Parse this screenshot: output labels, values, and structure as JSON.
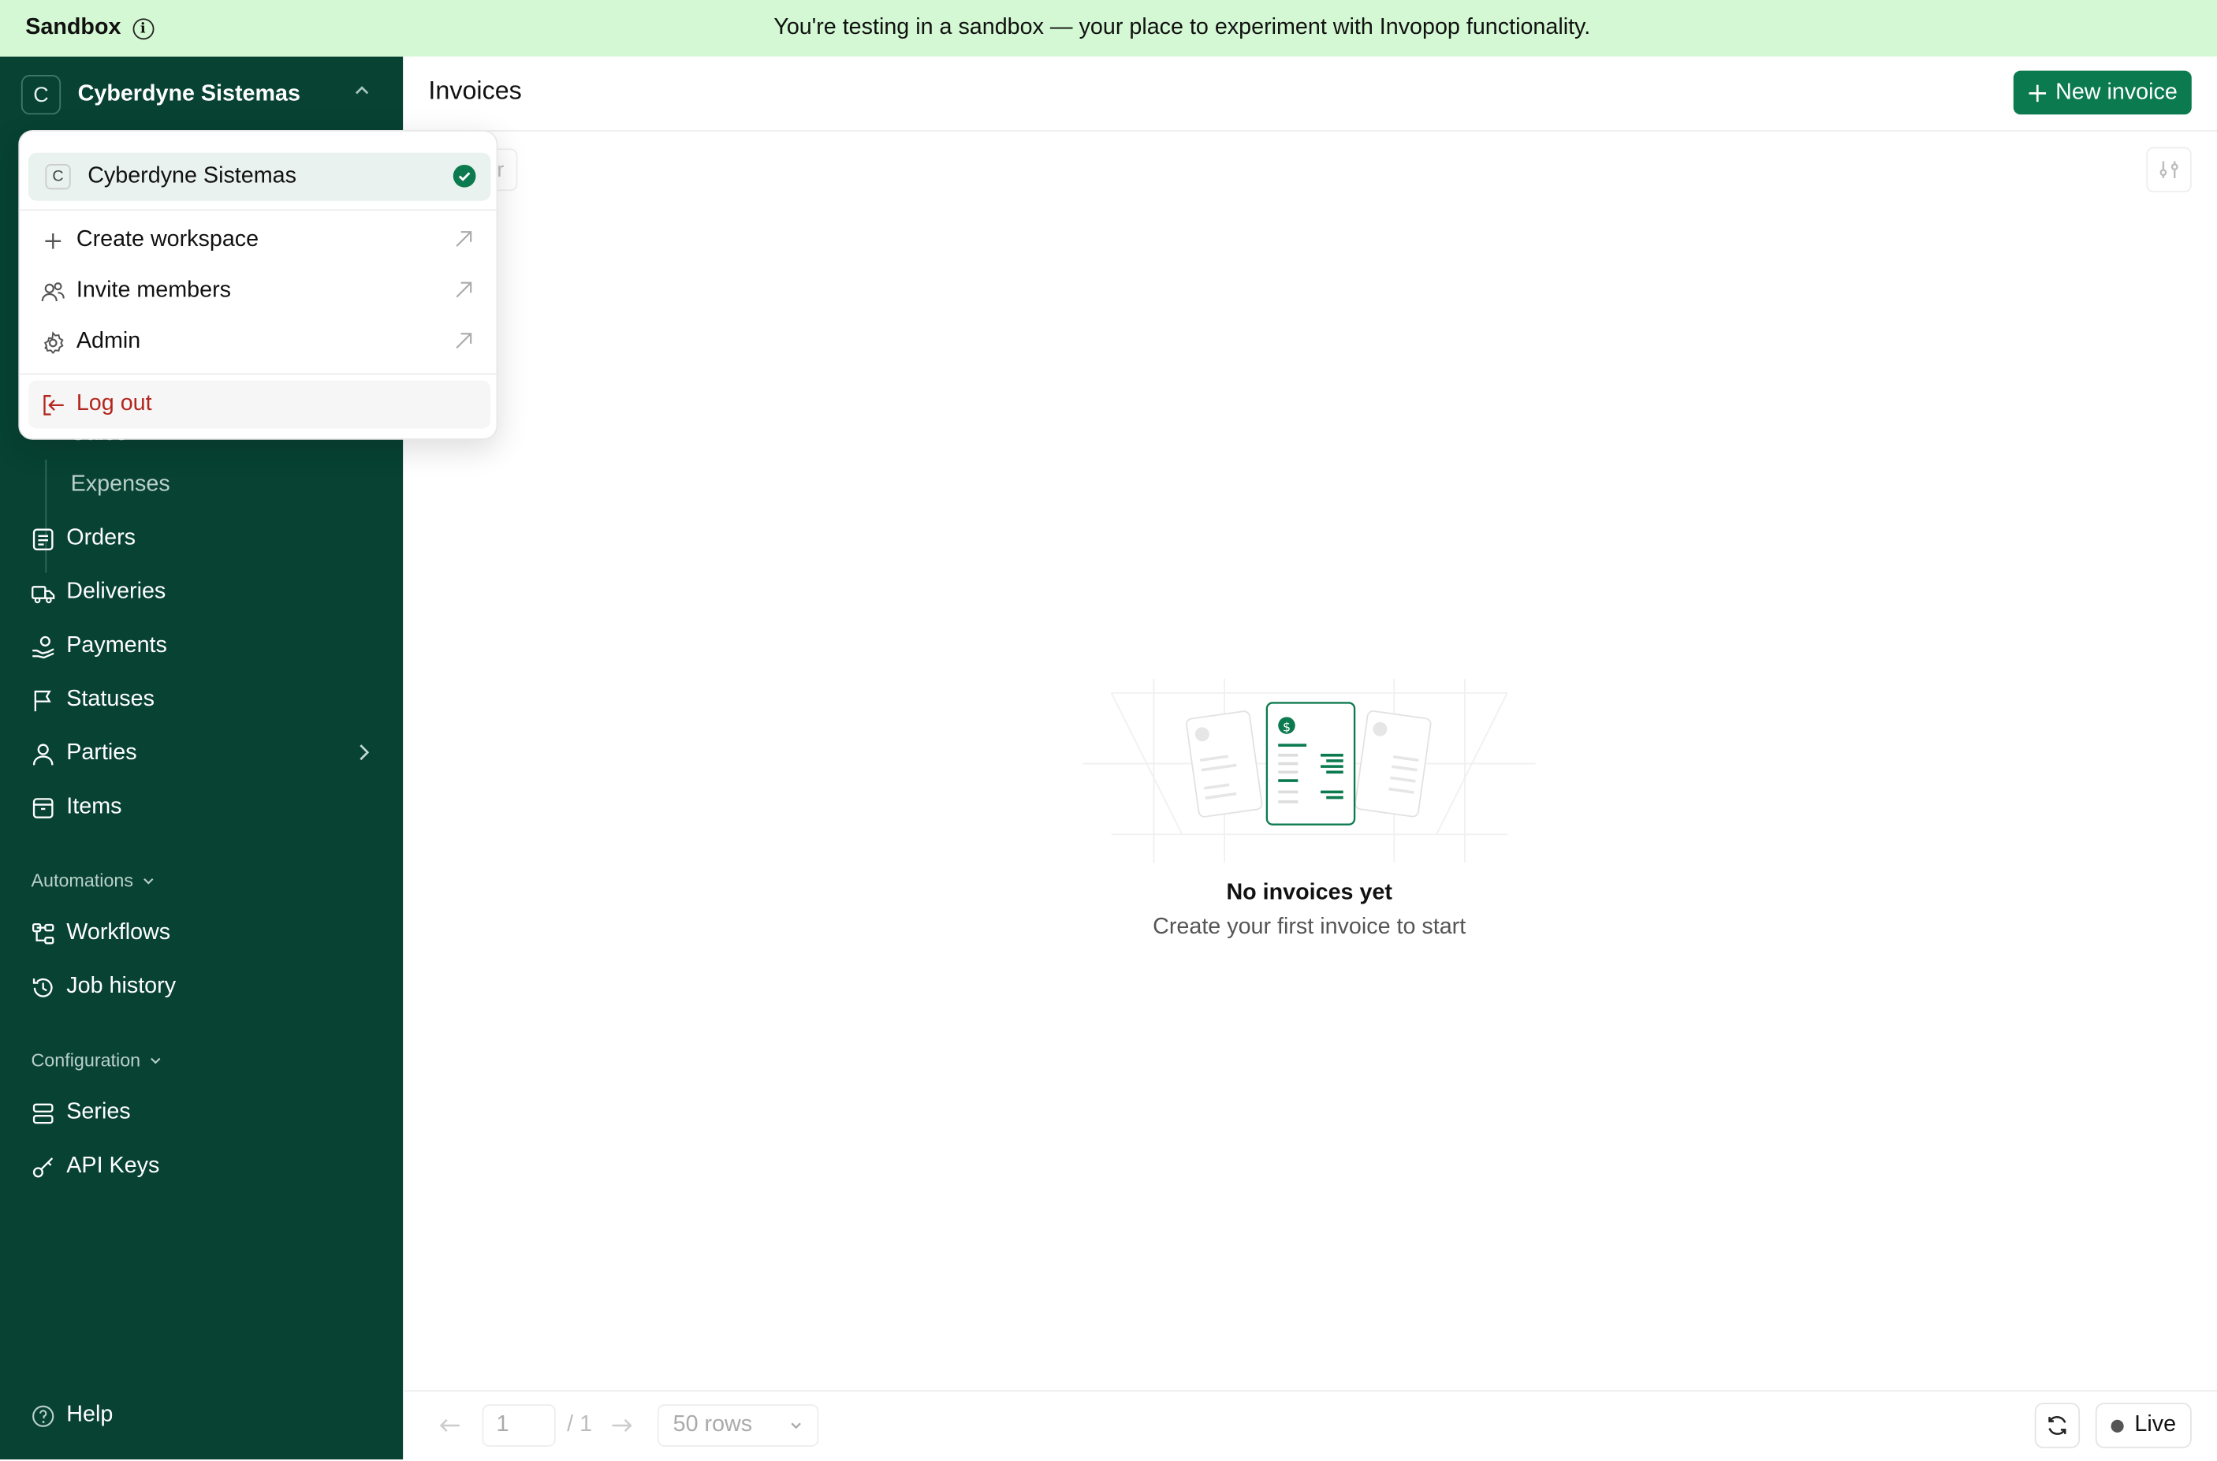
{
  "banner": {
    "label": "Sandbox",
    "message": "You're testing in a sandbox — your place to experiment with Invopop functionality."
  },
  "sidebar": {
    "workspace_initial": "C",
    "workspace_name": "Cyberdyne Sistemas",
    "partial_item": "Sales",
    "sub_items": [
      "Expenses"
    ],
    "items": [
      "Orders",
      "Deliveries",
      "Payments",
      "Statuses",
      "Parties",
      "Items"
    ],
    "sections": {
      "automations": {
        "label": "Automations",
        "items": [
          "Workflows",
          "Job history"
        ]
      },
      "configuration": {
        "label": "Configuration",
        "items": [
          "Series",
          "API Keys"
        ]
      }
    },
    "help": "Help"
  },
  "main": {
    "title": "Invoices",
    "new_button": "New invoice",
    "filter_partial": "ter",
    "empty_title": "No invoices yet",
    "empty_subtitle": "Create your first invoice to start"
  },
  "footer": {
    "page_value": "1",
    "page_total": "/ 1",
    "rows_select": "50 rows",
    "live": "Live"
  },
  "menu": {
    "workspace_initial": "C",
    "workspace_name": "Cyberdyne Sistemas",
    "items": [
      "Create workspace",
      "Invite members",
      "Admin"
    ],
    "logout": "Log out"
  },
  "colors": {
    "sidebar_bg": "#074232",
    "banner_bg": "#d3f8d3",
    "accent": "#0b7a4f",
    "logout": "#b3261e"
  }
}
